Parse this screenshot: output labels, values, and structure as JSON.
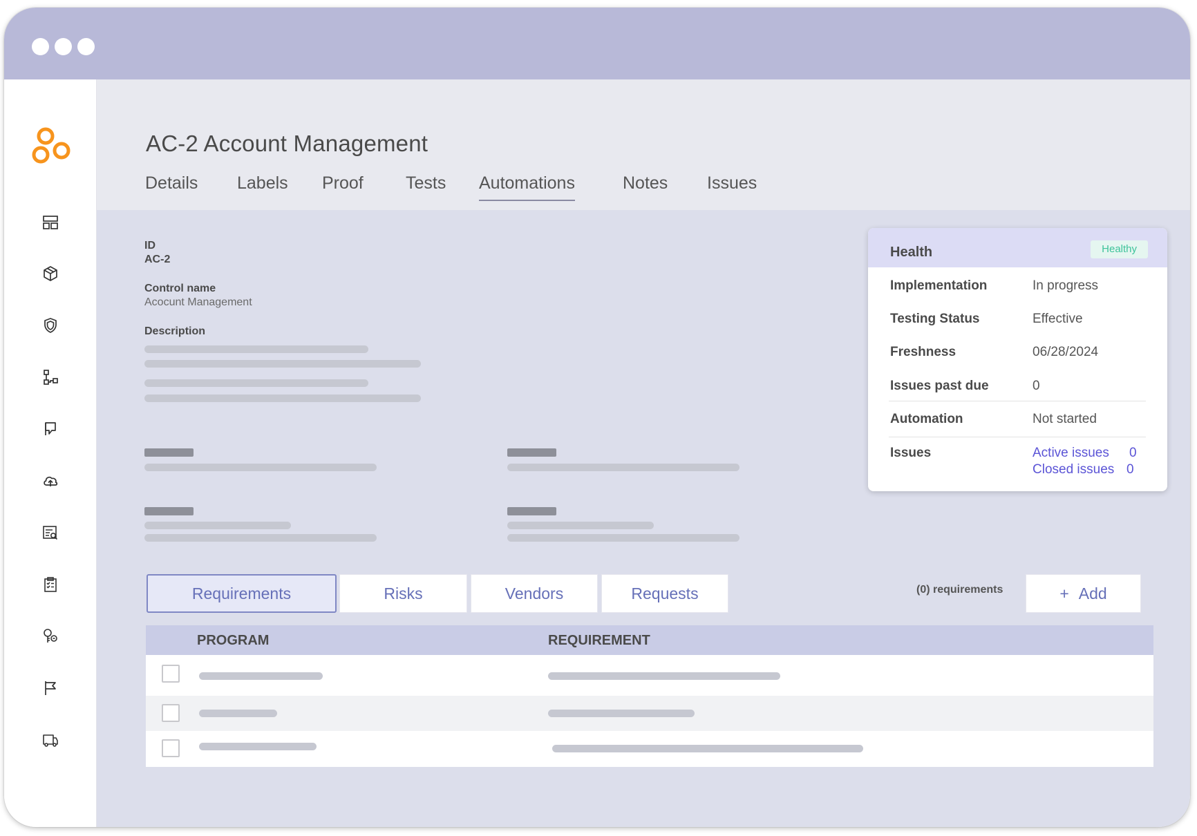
{
  "window": {
    "controls": [
      "window-dot-1",
      "window-dot-2",
      "window-dot-3"
    ]
  },
  "sidebar": {
    "logo": "orange-rings-logo",
    "items": [
      {
        "name": "dashboard-icon"
      },
      {
        "name": "package-icon"
      },
      {
        "name": "shield-icon"
      },
      {
        "name": "workflow-icon"
      },
      {
        "name": "bookmark-icon"
      },
      {
        "name": "cloud-upload-icon"
      },
      {
        "name": "report-search-icon"
      },
      {
        "name": "clipboard-check-icon"
      },
      {
        "name": "key-icon"
      },
      {
        "name": "flag-icon"
      },
      {
        "name": "truck-icon"
      }
    ]
  },
  "header": {
    "title": "AC-2 Account Management",
    "tabs": [
      {
        "label": "Details"
      },
      {
        "label": "Labels"
      },
      {
        "label": "Proof"
      },
      {
        "label": "Tests"
      },
      {
        "label": "Automations",
        "active": true
      },
      {
        "label": "Notes"
      },
      {
        "label": "Issues"
      }
    ]
  },
  "details": {
    "id_label": "ID",
    "id_value": "AC-2",
    "control_name_label": "Control name",
    "control_name_value": "Acocunt Management",
    "description_label": "Description"
  },
  "health": {
    "title": "Health",
    "badge": "Healthy",
    "badge_color": "#3ec39a",
    "rows": [
      {
        "label": "Implementation",
        "value": "In progress"
      },
      {
        "label": "Testing Status",
        "value": "Effective"
      },
      {
        "label": "Freshness",
        "value": "06/28/2024"
      },
      {
        "label": "Issues past due",
        "value": "0"
      },
      {
        "label": "Automation",
        "value": "Not started"
      }
    ],
    "issues_label": "Issues",
    "active_issues_label": "Active issues",
    "active_issues_count": "0",
    "closed_issues_label": "Closed issues",
    "closed_issues_count": "0",
    "link_color": "#5b54d6"
  },
  "related": {
    "tabs": [
      {
        "label": "Requirements",
        "active": true
      },
      {
        "label": "Risks"
      },
      {
        "label": "Vendors"
      },
      {
        "label": "Requests"
      }
    ],
    "count_text": "(0) requirements",
    "add_icon": "+",
    "add_label": "Add"
  },
  "table": {
    "columns": [
      "PROGRAM",
      "REQUIREMENT"
    ],
    "row_count": 3
  },
  "colors": {
    "titlebar": "#b8b9d8",
    "accent": "#6670b8",
    "brand": "#f7941d"
  }
}
